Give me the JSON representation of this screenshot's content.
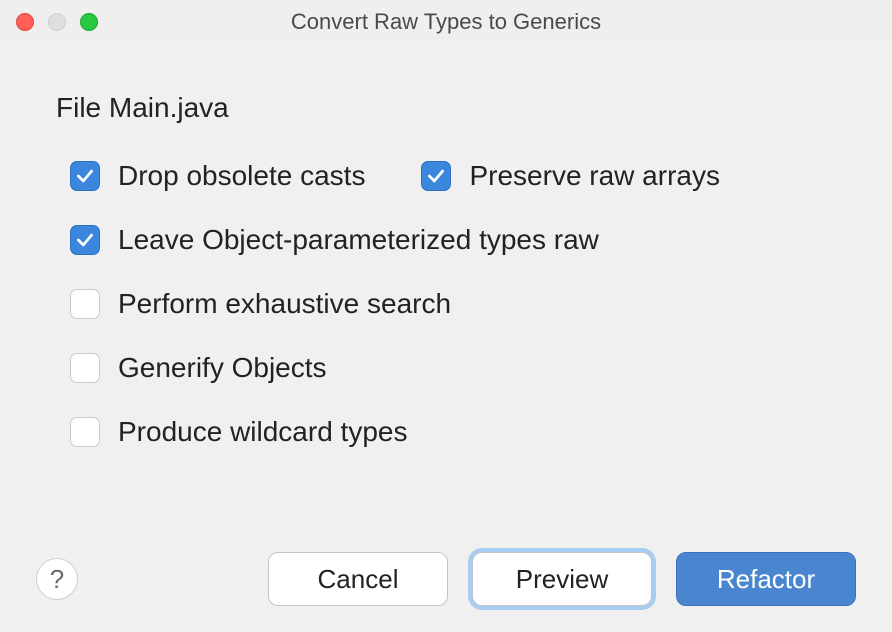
{
  "window": {
    "title": "Convert Raw Types to Generics"
  },
  "fileLabel": "File Main.java",
  "options": {
    "dropObsoleteCasts": {
      "label": "Drop obsolete casts",
      "checked": true
    },
    "preserveRawArrays": {
      "label": "Preserve raw arrays",
      "checked": true
    },
    "leaveObjectParameterized": {
      "label": "Leave Object-parameterized types raw",
      "checked": true
    },
    "performExhaustiveSearch": {
      "label": "Perform exhaustive search",
      "checked": false
    },
    "generifyObjects": {
      "label": "Generify Objects",
      "checked": false
    },
    "produceWildcardTypes": {
      "label": "Produce wildcard types",
      "checked": false
    }
  },
  "buttons": {
    "help": "?",
    "cancel": "Cancel",
    "preview": "Preview",
    "refactor": "Refactor"
  }
}
